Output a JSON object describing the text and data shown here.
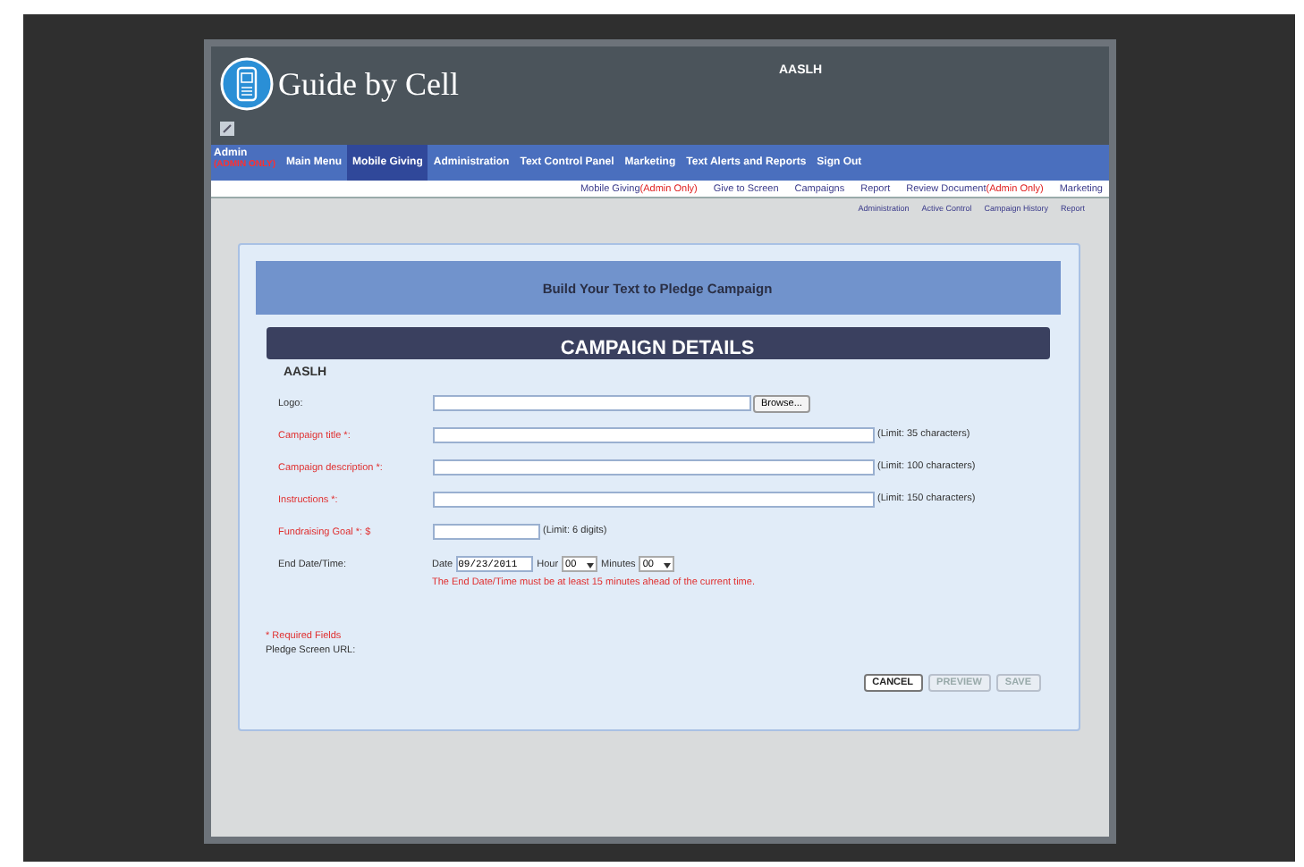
{
  "header": {
    "logo_text": "Guide by Cell",
    "account": "AASLH"
  },
  "nav": {
    "admin": {
      "label": "Admin",
      "note": "(ADMIN ONLY)"
    },
    "items": [
      {
        "label": "Main Menu",
        "selected": false
      },
      {
        "label": "Mobile Giving",
        "selected": true
      },
      {
        "label": "Administration",
        "selected": false
      },
      {
        "label": "Text Control Panel",
        "selected": false
      },
      {
        "label": "Marketing",
        "selected": false
      },
      {
        "label": "Text Alerts and Reports",
        "selected": false
      },
      {
        "label": "Sign Out",
        "selected": false
      }
    ]
  },
  "subnav": [
    {
      "label": "Mobile Giving",
      "note": "(Admin Only)"
    },
    {
      "label": "Give to Screen"
    },
    {
      "label": "Campaigns"
    },
    {
      "label": "Report"
    },
    {
      "label": "Review Document",
      "note": "(Admin Only)"
    },
    {
      "label": "Marketing"
    }
  ],
  "subnav2": [
    "Administration",
    "Active Control",
    "Campaign History",
    "Report"
  ],
  "form": {
    "title": "Build Your Text to Pledge Campaign",
    "section": "CAMPAIGN DETAILS",
    "org": "AASLH",
    "fields": [
      {
        "kind": "file",
        "label": "Logo:",
        "required": false,
        "button": "Browse..."
      },
      {
        "kind": "text",
        "label": "Campaign title *:",
        "required": true,
        "hint": "(Limit: 35 characters)"
      },
      {
        "kind": "text",
        "label": "Campaign description *:",
        "required": true,
        "hint": "(Limit: 100 characters)"
      },
      {
        "kind": "text",
        "label": "Instructions *:",
        "required": true,
        "hint": "(Limit: 150 characters)"
      },
      {
        "kind": "money",
        "label": "Fundraising Goal *: $",
        "required": true,
        "hint": "(Limit: 6 digits)"
      },
      {
        "kind": "datetime",
        "label": "End Date/Time:",
        "required": false,
        "date_label": "Date",
        "date": "09/23/2011",
        "hour_label": "Hour",
        "hour": "00",
        "minutes_label": "Minutes",
        "minutes": "00",
        "warning": "The End Date/Time must be at least 15 minutes ahead of the current time."
      }
    ],
    "required_note": "* Required Fields",
    "url_label": "Pledge Screen URL:",
    "buttons": [
      {
        "label": "CANCEL",
        "disabled": false
      },
      {
        "label": "PREVIEW",
        "disabled": true
      },
      {
        "label": "SAVE",
        "disabled": true
      }
    ]
  }
}
